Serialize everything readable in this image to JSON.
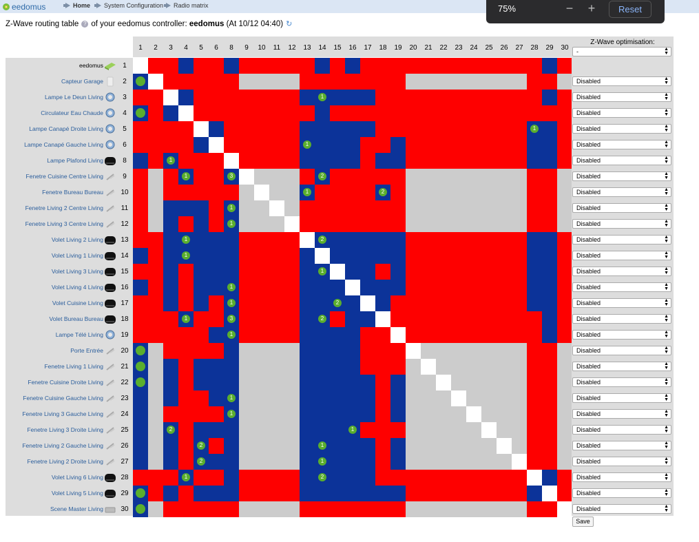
{
  "app": {
    "logo_text": "eedomus"
  },
  "breadcrumb": [
    "Home",
    "System Configuration",
    "Radio matrix"
  ],
  "zoom": {
    "value": "75%",
    "minus": "−",
    "plus": "+",
    "reset": "Reset"
  },
  "heading": {
    "prefix": "Z-Wave routing table",
    "middle": "of your eedomus controller:",
    "controller": "eedomus",
    "timestamp": "(At 10/12 04:40)"
  },
  "optimisation": {
    "title": "Z-Wave optimisation:",
    "top_value": "-",
    "save_label": "Save"
  },
  "colors": {
    "red": "#fe0000",
    "blue": "#0c3399",
    "white": "#ffffff",
    "gray": "#cccccc",
    "badge": "#5aae2e",
    "link": "#2b5e9c"
  },
  "columns": [
    "1",
    "2",
    "3",
    "4",
    "5",
    "6",
    "8",
    "9",
    "10",
    "11",
    "12",
    "13",
    "14",
    "15",
    "16",
    "17",
    "18",
    "19",
    "20",
    "21",
    "22",
    "23",
    "24",
    "25",
    "26",
    "27",
    "28",
    "29",
    "30"
  ],
  "rows": [
    {
      "name": "eedomus",
      "num": "1",
      "icon": "controller-icon",
      "opt": "",
      "cells": "WRRBRRBRRRRRBRBRRRRRRRRRRRRBR"
    },
    {
      "name": "Capteur Garage",
      "num": "2",
      "icon": "sensor-icon",
      "opt": "Disabled",
      "cells": "BWRRRRRGGGGRRRRRRRGGGGGGGGRRG"
    },
    {
      "name": "Lampe Le Deun Living",
      "num": "3",
      "icon": "bulb-icon",
      "opt": "Disabled",
      "cells": "RRWBRRRRRRRBBBBBRRRRRRRRRRRBR"
    },
    {
      "name": "Circulateur Eau Chaude",
      "num": "4",
      "icon": "bulb-icon",
      "opt": "Disabled",
      "cells": "BRBWRRRRRRRRBRRRRRRRRRRRRRRRR"
    },
    {
      "name": "Lampe Canapé Droite Living",
      "num": "5",
      "icon": "bulb-icon",
      "opt": "Disabled",
      "cells": "RRRRWBRRRRRBBBBBRRRRRRRRRRBBR"
    },
    {
      "name": "Lampe Canapé Gauche Living",
      "num": "6",
      "icon": "bulb-icon",
      "opt": "Disabled",
      "cells": "RRRRBWRRRRRBBBBRRBRRRRRRRRBBR"
    },
    {
      "name": "Lampe Plafond Living",
      "num": "8",
      "icon": "module-icon",
      "opt": "Disabled",
      "cells": "BRBRRRWRRRRBBBBRBBRRRRRRRRBBR"
    },
    {
      "name": "Fenetre Cuisine Centre Living",
      "num": "9",
      "icon": "window-sensor-icon",
      "opt": "Disabled",
      "cells": "RGRBRRBWGGGRBRRRRRGGGGGGGGRRG"
    },
    {
      "name": "Fenetre Bureau Bureau",
      "num": "10",
      "icon": "window-sensor-icon",
      "opt": "Disabled",
      "cells": "RGRRRRRGWGGBRRRRBRGGGGGGGGRRG"
    },
    {
      "name": "Fenetre Living 2 Centre Living",
      "num": "11",
      "icon": "window-sensor-icon",
      "opt": "Disabled",
      "cells": "RGBBBRBGGWGRRRRRRRGGGGGGGGRRG"
    },
    {
      "name": "Fenetre Living 3 Centre Living",
      "num": "12",
      "icon": "window-sensor-icon",
      "opt": "Disabled",
      "cells": "RGBRBRBGGGWRRRRRRRGGGGGGGGRRG"
    },
    {
      "name": "Volet Living 2 Living",
      "num": "13",
      "icon": "module-icon",
      "opt": "Disabled",
      "cells": "RRBBBBBRRRRWBBBBBBRRRRRRRRBBR"
    },
    {
      "name": "Volet Living 1 Living",
      "num": "14",
      "icon": "module-icon",
      "opt": "Disabled",
      "cells": "BRBBBBBRRRRBWBBBBBRRRRRRRRBBR"
    },
    {
      "name": "Volet Living 3 Living",
      "num": "15",
      "icon": "module-icon",
      "opt": "Disabled",
      "cells": "RRBRBBBRRRRBBWBBRBRRRRRRRRBBR"
    },
    {
      "name": "Volet Living 4 Living",
      "num": "16",
      "icon": "module-icon",
      "opt": "Disabled",
      "cells": "BRBRBBBRRRRBBBWBBBRRRRRRRRBBR"
    },
    {
      "name": "Volet Cuisine Living",
      "num": "17",
      "icon": "module-icon",
      "opt": "Disabled",
      "cells": "RRBRBRBRRRRBBBBWBRRRRRRRRRBBR"
    },
    {
      "name": "Volet Bureau Bureau",
      "num": "18",
      "icon": "module-icon",
      "opt": "Disabled",
      "cells": "RRRBRRBRRRRBBRBBWRRRRRRRRRRBR"
    },
    {
      "name": "Lampe Télé Living",
      "num": "19",
      "icon": "bulb-icon",
      "opt": "Disabled",
      "cells": "RRRRRBBRRRRBBBBRRWRRRRRRRRRBR"
    },
    {
      "name": "Porte Entrée",
      "num": "20",
      "icon": "window-sensor-icon",
      "opt": "Disabled",
      "cells": "BGRRRRBGGGGBBBBRRRWGGGGGGGRRG"
    },
    {
      "name": "Fenetre Living 1 Living",
      "num": "21",
      "icon": "window-sensor-icon",
      "opt": "Disabled",
      "cells": "BGBRBBBGGGGBBBBRRRGWGGGGGGRRG"
    },
    {
      "name": "Fenetre Cuisine Droite Living",
      "num": "22",
      "icon": "window-sensor-icon",
      "opt": "Disabled",
      "cells": "BGBRBBBGGGGBBBBBRBGGWGGGGGRRG"
    },
    {
      "name": "Fenetre Cuisine Gauche Living",
      "num": "23",
      "icon": "window-sensor-icon",
      "opt": "Disabled",
      "cells": "BGBRRBBGGGGBBBBBRBGGGWGGGGRRG"
    },
    {
      "name": "Fenetre Living 3 Gauche Living",
      "num": "24",
      "icon": "window-sensor-icon",
      "opt": "Disabled",
      "cells": "BGRRRRBGGGGBBBBBRBGGGGWGGGRRG"
    },
    {
      "name": "Fenetre Living 3 Droite Living",
      "num": "25",
      "icon": "window-sensor-icon",
      "opt": "Disabled",
      "cells": "BGBRBBBGGGGBBBBRRRGGGGGWGGRRG"
    },
    {
      "name": "Fenetre Living 2 Gauche Living",
      "num": "26",
      "icon": "window-sensor-icon",
      "opt": "Disabled",
      "cells": "BGBRBRBGGGGBBBBBRBGGGGGGWGRRG"
    },
    {
      "name": "Fenetre Living 2 Droite Living",
      "num": "27",
      "icon": "window-sensor-icon",
      "opt": "Disabled",
      "cells": "BGBRBBBGGGGBBBBBRBGGGGGGGWRRG"
    },
    {
      "name": "Volet Living 6 Living",
      "num": "28",
      "icon": "module-icon",
      "opt": "Disabled",
      "cells": "RRRBRRBRRRRBBBBBRRRRRRRRRRWBR"
    },
    {
      "name": "Volet Living 5 Living",
      "num": "29",
      "icon": "module-icon",
      "opt": "Disabled",
      "cells": "BRBRBBBRRRRBBBBBBBRRRRRRRRBWR"
    },
    {
      "name": "Scene Master Living",
      "num": "30",
      "icon": "remote-icon",
      "opt": "Disabled",
      "cells": "BGRRRRRGGGGRRRRRRRGGGGGGGGRRW"
    }
  ],
  "badges": [
    {
      "row": 1,
      "col": 0,
      "text": ""
    },
    {
      "row": 3,
      "col": 0,
      "text": ""
    },
    {
      "row": 2,
      "col": 12,
      "text": "1"
    },
    {
      "row": 4,
      "col": 26,
      "text": "1"
    },
    {
      "row": 5,
      "col": 11,
      "text": "1"
    },
    {
      "row": 6,
      "col": 2,
      "text": "1"
    },
    {
      "row": 7,
      "col": 3,
      "text": "1"
    },
    {
      "row": 7,
      "col": 6,
      "text": "3"
    },
    {
      "row": 7,
      "col": 12,
      "text": "2"
    },
    {
      "row": 8,
      "col": 11,
      "text": "1"
    },
    {
      "row": 8,
      "col": 16,
      "text": "2"
    },
    {
      "row": 9,
      "col": 6,
      "text": "1"
    },
    {
      "row": 10,
      "col": 6,
      "text": "1"
    },
    {
      "row": 11,
      "col": 3,
      "text": "1"
    },
    {
      "row": 11,
      "col": 12,
      "text": "2"
    },
    {
      "row": 12,
      "col": 3,
      "text": "1"
    },
    {
      "row": 13,
      "col": 12,
      "text": "1"
    },
    {
      "row": 14,
      "col": 6,
      "text": "1"
    },
    {
      "row": 15,
      "col": 6,
      "text": "1"
    },
    {
      "row": 15,
      "col": 13,
      "text": "2"
    },
    {
      "row": 16,
      "col": 3,
      "text": "1"
    },
    {
      "row": 16,
      "col": 6,
      "text": "3"
    },
    {
      "row": 16,
      "col": 12,
      "text": "2"
    },
    {
      "row": 17,
      "col": 6,
      "text": "1"
    },
    {
      "row": 18,
      "col": 0,
      "text": ""
    },
    {
      "row": 19,
      "col": 0,
      "text": ""
    },
    {
      "row": 20,
      "col": 0,
      "text": ""
    },
    {
      "row": 21,
      "col": 6,
      "text": "1"
    },
    {
      "row": 22,
      "col": 6,
      "text": "1"
    },
    {
      "row": 23,
      "col": 2,
      "text": "2"
    },
    {
      "row": 23,
      "col": 14,
      "text": "1"
    },
    {
      "row": 24,
      "col": 4,
      "text": "2"
    },
    {
      "row": 24,
      "col": 12,
      "text": "1"
    },
    {
      "row": 25,
      "col": 4,
      "text": "2"
    },
    {
      "row": 25,
      "col": 12,
      "text": "1"
    },
    {
      "row": 26,
      "col": 3,
      "text": "1"
    },
    {
      "row": 26,
      "col": 12,
      "text": "2"
    },
    {
      "row": 27,
      "col": 0,
      "text": ""
    },
    {
      "row": 28,
      "col": 0,
      "text": ""
    }
  ]
}
